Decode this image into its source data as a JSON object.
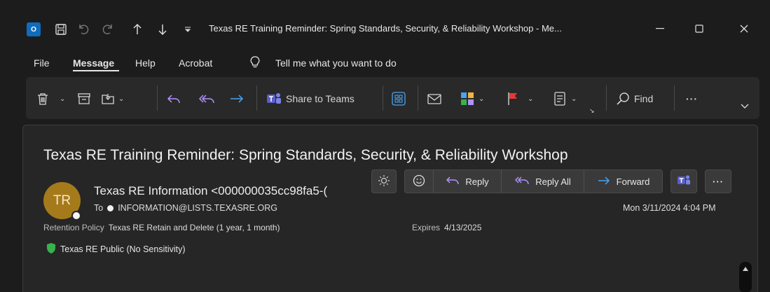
{
  "titlebar": {
    "title": "Texas RE Training Reminder: Spring Standards, Security, & Reliability Workshop  -  Me...",
    "app_icon_label": "O"
  },
  "menu": {
    "items": [
      "File",
      "Message",
      "Help",
      "Acrobat"
    ],
    "tell_me": "Tell me what you want to do"
  },
  "ribbon": {
    "share_to_teams": "Share to Teams",
    "find": "Find",
    "more": "···"
  },
  "email": {
    "subject": "Texas RE Training Reminder: Spring Standards, Security, & Reliability Workshop",
    "avatar_initials": "TR",
    "sender": "Texas RE Information <000000035cc98fa5-(",
    "to_label": "To",
    "to_address": "INFORMATION@LISTS.TEXASRE.ORG",
    "retention_label": "Retention Policy",
    "retention_value": "Texas RE Retain and Delete (1 year, 1 month)",
    "expires_label": "Expires",
    "expires_value": "4/13/2025",
    "sensitivity": "Texas RE Public (No Sensitivity)",
    "date": "Mon 3/11/2024 4:04 PM"
  },
  "actions": {
    "reply": "Reply",
    "reply_all": "Reply All",
    "forward": "Forward",
    "more": "···"
  },
  "colors": {
    "accent_blue": "#4aa3f0",
    "accent_purple": "#b191ff",
    "flag_red": "#e53935",
    "avatar": "#a57a1b",
    "shield_green": "#37b24d"
  }
}
